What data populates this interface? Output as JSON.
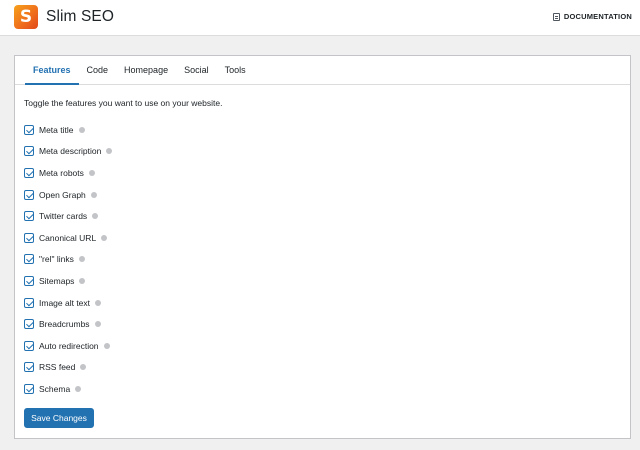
{
  "header": {
    "app_title": "Slim SEO",
    "logo_letter": "S",
    "documentation_label": "DOCUMENTATION"
  },
  "tabs": [
    {
      "label": "Features",
      "active": true
    },
    {
      "label": "Code",
      "active": false
    },
    {
      "label": "Homepage",
      "active": false
    },
    {
      "label": "Social",
      "active": false
    },
    {
      "label": "Tools",
      "active": false
    }
  ],
  "intro_text": "Toggle the features you want to use on your website.",
  "features": [
    {
      "label": "Meta title",
      "checked": true
    },
    {
      "label": "Meta description",
      "checked": true
    },
    {
      "label": "Meta robots",
      "checked": true
    },
    {
      "label": "Open Graph",
      "checked": true
    },
    {
      "label": "Twitter cards",
      "checked": true
    },
    {
      "label": "Canonical URL",
      "checked": true
    },
    {
      "label": "\"rel\" links",
      "checked": true
    },
    {
      "label": "Sitemaps",
      "checked": true
    },
    {
      "label": "Image alt text",
      "checked": true
    },
    {
      "label": "Breadcrumbs",
      "checked": true
    },
    {
      "label": "Auto redirection",
      "checked": true
    },
    {
      "label": "RSS feed",
      "checked": true
    },
    {
      "label": "Schema",
      "checked": true
    }
  ],
  "save_label": "Save Changes",
  "colors": {
    "accent": "#2271b1",
    "background": "#f0f0f1",
    "logo_orange": "#ef6b1c"
  }
}
